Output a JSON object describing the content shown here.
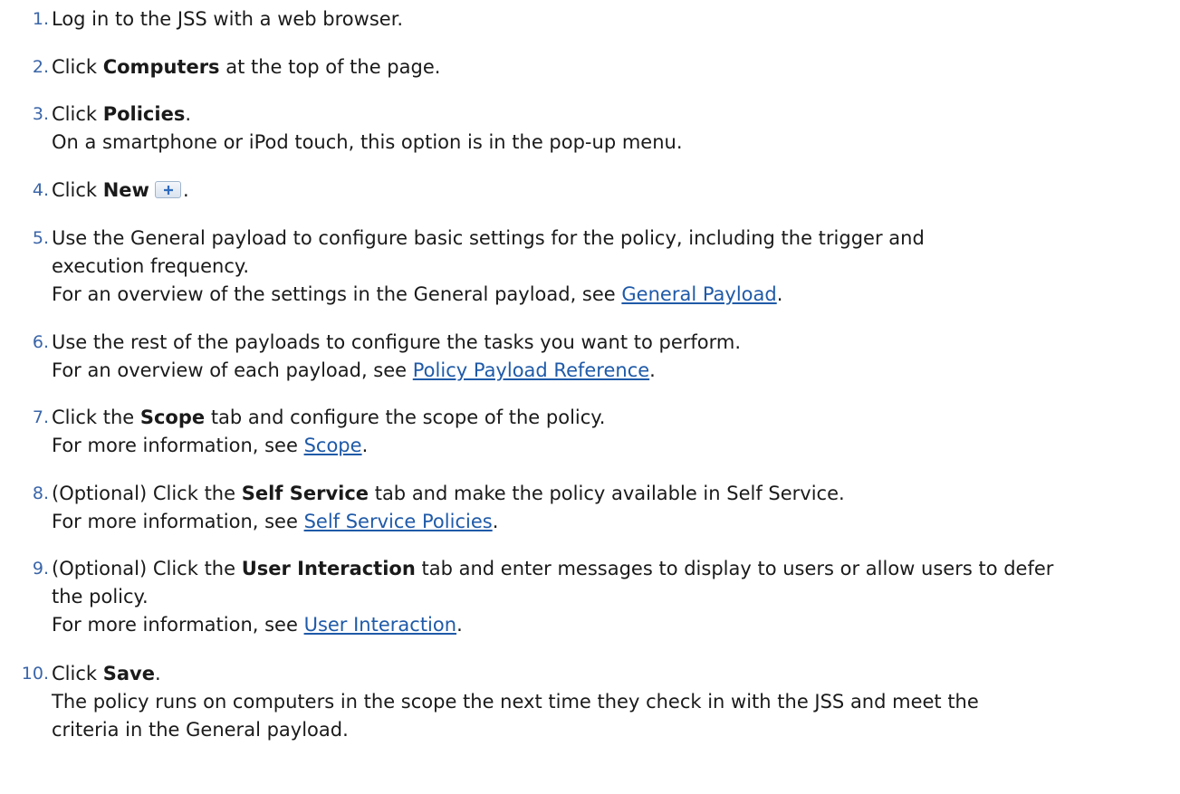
{
  "steps": [
    {
      "num": "1.",
      "line1": "Log in to the JSS with a web browser."
    },
    {
      "num": "2.",
      "pre": "Click ",
      "bold": "Computers",
      "post": " at the top of the page."
    },
    {
      "num": "3.",
      "pre": "Click ",
      "bold": "Policies",
      "post": ".",
      "note": "On a smartphone or iPod touch, this option is in the pop-up menu."
    },
    {
      "num": "4.",
      "pre": "Click ",
      "bold": "New",
      "post": ".",
      "icon": "plus-icon"
    },
    {
      "num": "5.",
      "line1": "Use the General payload to configure basic settings for the policy, including the trigger and",
      "line2": "execution frequency.",
      "note_pre": "For an overview of the settings in the General payload, see ",
      "link": "General Payload",
      "note_post": "."
    },
    {
      "num": "6.",
      "line1": "Use the rest of the payloads to configure the tasks you want to perform.",
      "note_pre": "For an overview of each payload, see ",
      "link": "Policy Payload Reference",
      "note_post": "."
    },
    {
      "num": "7.",
      "pre": "Click the ",
      "bold": "Scope",
      "post": " tab and configure the scope of the policy.",
      "note_pre": "For more information, see ",
      "link": "Scope",
      "note_post": "."
    },
    {
      "num": "8.",
      "pre": "(Optional) Click the ",
      "bold": "Self Service",
      "post": " tab and make the policy available in Self Service.",
      "note_pre": "For more information, see ",
      "link": "Self Service Policies",
      "note_post": "."
    },
    {
      "num": "9.",
      "pre": "(Optional) Click the ",
      "bold": "User Interaction",
      "post": " tab and enter messages to display to users or allow users to defer",
      "line2": "the policy.",
      "note_pre": "For more information, see ",
      "link": "User Interaction",
      "note_post": "."
    },
    {
      "num": "10.",
      "pre": "Click ",
      "bold": "Save",
      "post": ".",
      "note": "The policy runs on computers in the scope the next time they check in with the JSS and meet the",
      "note2": "criteria in the General payload."
    }
  ]
}
